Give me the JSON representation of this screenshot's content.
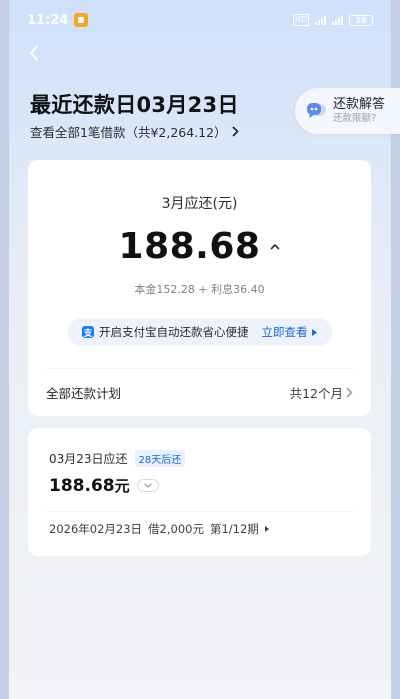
{
  "status_bar": {
    "time": "11:24",
    "hd_label": "HD",
    "battery": "29"
  },
  "header": {
    "title": "最近还款日03月23日",
    "all_loans_link": "查看全部1笔借款（共¥2,264.12）"
  },
  "faq": {
    "title": "还款解答",
    "subtitle": "还款限额?"
  },
  "current_bill": {
    "label": "3月应还(元)",
    "amount": "188.68",
    "breakdown": "本金152.28 + 利息36.40",
    "promo_text": "开启支付宝自动还款省心便捷",
    "promo_link": "立即查看",
    "plan_label": "全部还款计划",
    "plan_count": "共12个月"
  },
  "next_bill": {
    "due_label": "03月23日应还",
    "due_badge": "28天后还",
    "amount": "188.68",
    "unit": "元",
    "loan_date": "2026年02月23日",
    "loan_amount": "借2,000元",
    "loan_period": "第1/12期"
  },
  "colors": {
    "accent": "#1767d8",
    "promo_bg": "#eef3fb",
    "alipay": "#1677ff"
  },
  "icons": {
    "back": "chevron-left-icon",
    "subline_arrow": "chevron-right-icon",
    "amount_toggle": "chevron-up-icon",
    "promo_arrow": "triangle-right-icon",
    "plan_arrow": "chevron-right-icon",
    "expand": "chevron-down-icon",
    "faq": "chat-bubble-icon"
  }
}
